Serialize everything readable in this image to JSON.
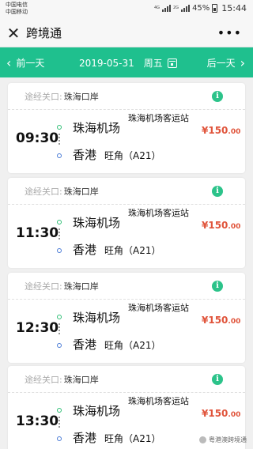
{
  "status_bar": {
    "carrier1": "中国电信",
    "carrier2": "中国移动",
    "net1": "4G",
    "net2": "2G",
    "battery": "45%",
    "time": "15:44"
  },
  "title_bar": {
    "close_icon": "close-icon",
    "title": "跨境通",
    "more": "•••"
  },
  "date_bar": {
    "prev_label": "前一天",
    "date": "2019-05-31",
    "weekday": "周五",
    "next_label": "后一天",
    "accent": "#1fc08e"
  },
  "trips": [
    {
      "via_label": "途经关口:",
      "via": "珠海口岸",
      "time": "09:30",
      "from_city": "珠海机场",
      "from_station": "珠海机场客运站",
      "to_city": "香港",
      "to_station": "旺角（A21）",
      "price": "¥150",
      "cents": ".00"
    },
    {
      "via_label": "途经关口:",
      "via": "珠海口岸",
      "time": "11:30",
      "from_city": "珠海机场",
      "from_station": "珠海机场客运站",
      "to_city": "香港",
      "to_station": "旺角（A21）",
      "price": "¥150",
      "cents": ".00"
    },
    {
      "via_label": "途经关口:",
      "via": "珠海口岸",
      "time": "12:30",
      "from_city": "珠海机场",
      "from_station": "珠海机场客运站",
      "to_city": "香港",
      "to_station": "旺角（A21）",
      "price": "¥150",
      "cents": ".00"
    },
    {
      "via_label": "途经关口:",
      "via": "珠海口岸",
      "time": "13:30",
      "from_city": "珠海机场",
      "from_station": "珠海机场客运站",
      "to_city": "香港",
      "to_station": "旺角（A21）",
      "price": "¥150",
      "cents": ".00"
    }
  ],
  "watermark": "粤港澳跨境通"
}
